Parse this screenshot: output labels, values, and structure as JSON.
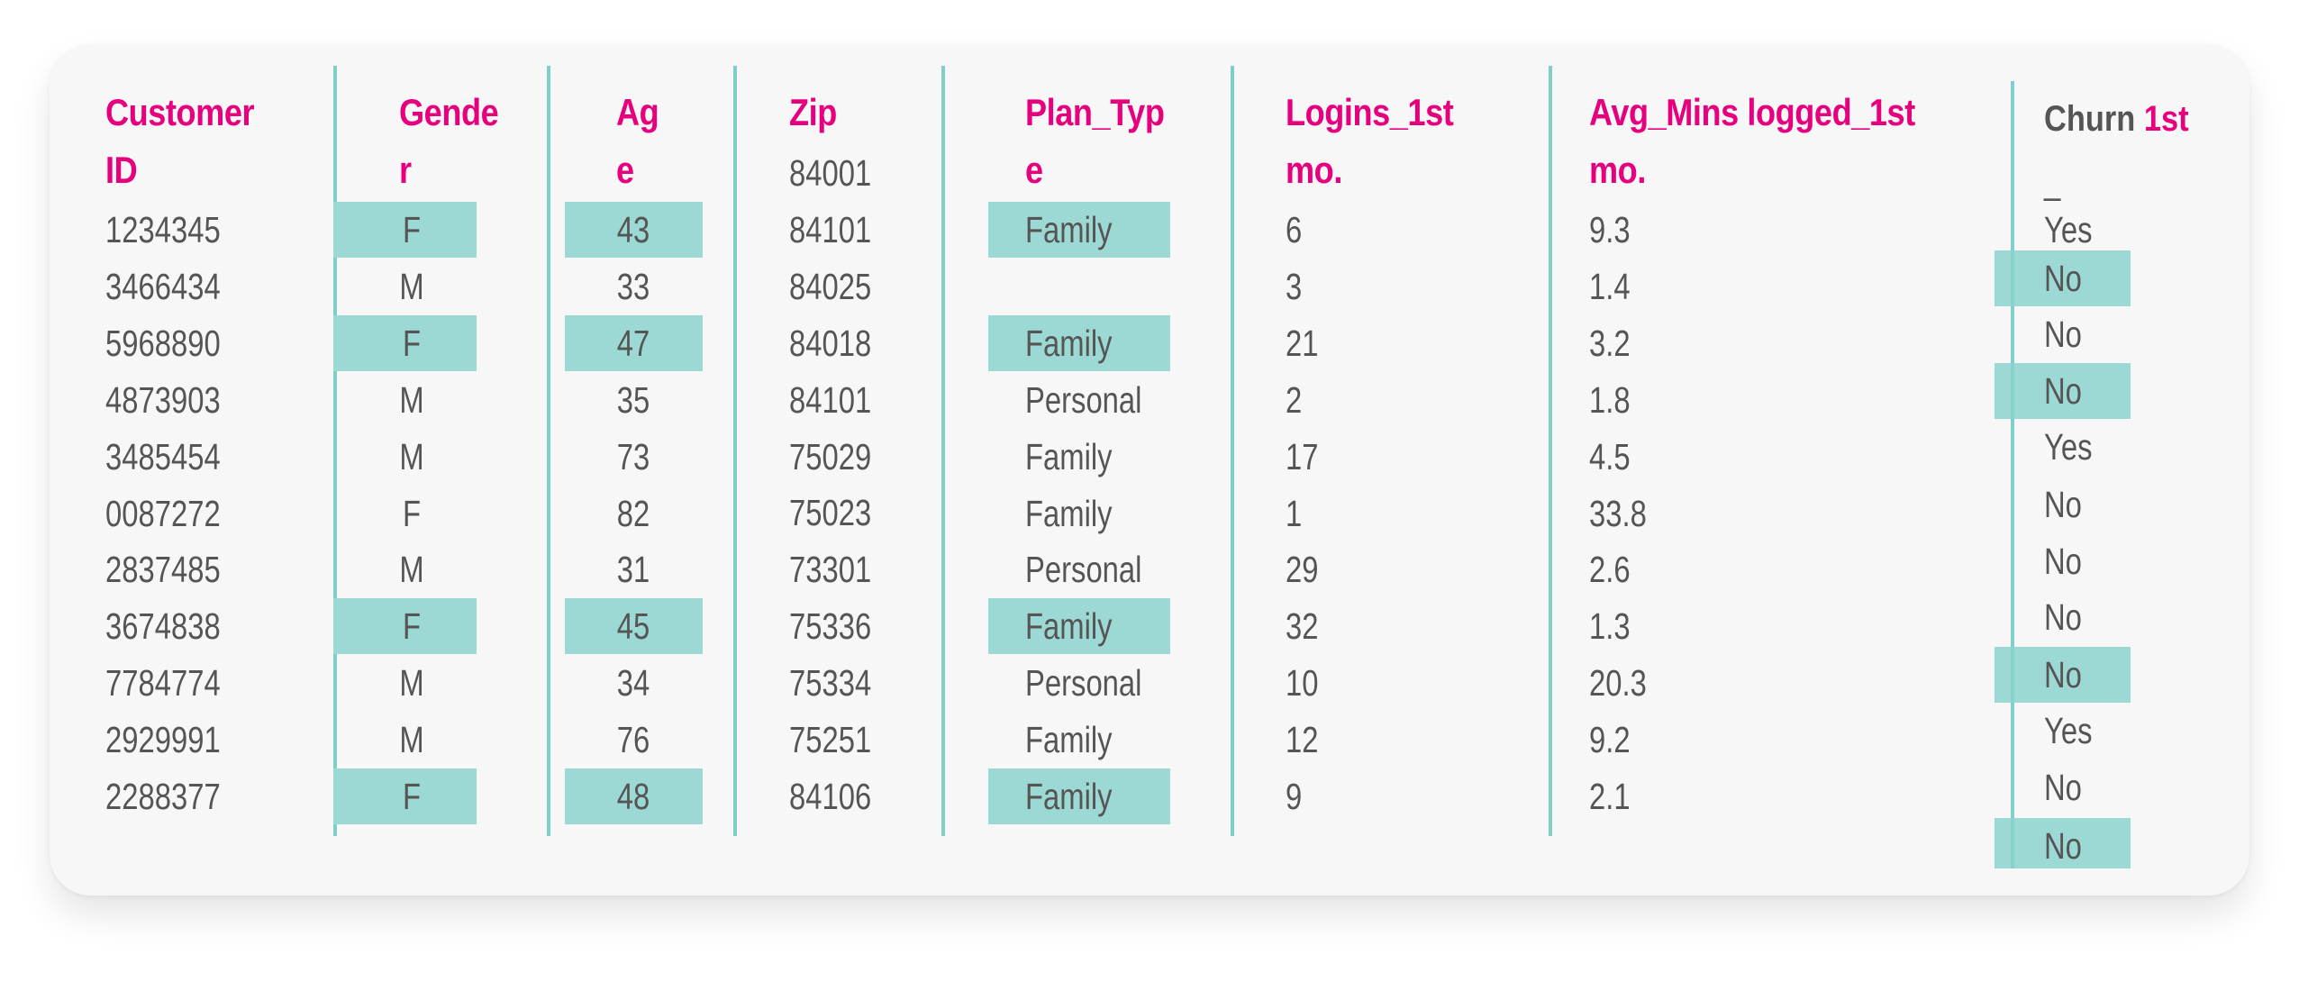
{
  "colors": {
    "header_text": "#e6007e",
    "body_text": "#555555",
    "divider": "#7fcfc9",
    "highlight": "#9dd9d4",
    "card_background": "#f7f7f7"
  },
  "headers": {
    "customer_id": [
      "Customer",
      "ID"
    ],
    "gender": [
      "Gende",
      "r"
    ],
    "age": [
      "Ag",
      "e"
    ],
    "zip": [
      "Zip"
    ],
    "plan_type": [
      "Plan_Typ",
      "e"
    ],
    "logins": [
      "Logins_1st",
      "mo."
    ],
    "avg_mins": [
      "Avg_Mins logged_1st",
      "mo."
    ],
    "churn": {
      "part1": "Churn",
      "part2": "1st",
      "line2": "_"
    }
  },
  "rows": [
    {
      "customer_id": "1234345",
      "gender": "F",
      "age": "43",
      "plan_type": "Family",
      "logins": "6",
      "avg_mins": "9.3",
      "highlight": true
    },
    {
      "customer_id": "3466434",
      "gender": "M",
      "age": "33",
      "plan_type": "",
      "logins": "3",
      "avg_mins": "1.4",
      "highlight": false
    },
    {
      "customer_id": "5968890",
      "gender": "F",
      "age": "47",
      "plan_type": "Family",
      "logins": "21",
      "avg_mins": "3.2",
      "highlight": true
    },
    {
      "customer_id": "4873903",
      "gender": "M",
      "age": "35",
      "plan_type": "Personal",
      "logins": "2",
      "avg_mins": "1.8",
      "highlight": false
    },
    {
      "customer_id": "3485454",
      "gender": "M",
      "age": "73",
      "plan_type": "Family",
      "logins": "17",
      "avg_mins": "4.5",
      "highlight": false
    },
    {
      "customer_id": "0087272",
      "gender": "F",
      "age": "82",
      "plan_type": "Family",
      "logins": "1",
      "avg_mins": "33.8",
      "highlight": false
    },
    {
      "customer_id": "2837485",
      "gender": "M",
      "age": "31",
      "plan_type": "Personal",
      "logins": "29",
      "avg_mins": "2.6",
      "highlight": false
    },
    {
      "customer_id": "3674838",
      "gender": "F",
      "age": "45",
      "plan_type": "Family",
      "logins": "32",
      "avg_mins": "1.3",
      "highlight": true
    },
    {
      "customer_id": "7784774",
      "gender": "M",
      "age": "34",
      "plan_type": "Personal",
      "logins": "10",
      "avg_mins": "20.3",
      "highlight": false
    },
    {
      "customer_id": "2929991",
      "gender": "M",
      "age": "76",
      "plan_type": "Family",
      "logins": "12",
      "avg_mins": "9.2",
      "highlight": false
    },
    {
      "customer_id": "2288377",
      "gender": "F",
      "age": "48",
      "plan_type": "Family",
      "logins": "9",
      "avg_mins": "2.1",
      "highlight": true
    }
  ],
  "zip_values": [
    "84001",
    "84101",
    "84025",
    "84018",
    "84101",
    "75029",
    "75023",
    "73301",
    "75336",
    "75334",
    "75251",
    "84106"
  ],
  "churn_values": [
    {
      "value": "Yes",
      "highlight": false
    },
    {
      "value": "No",
      "highlight": true
    },
    {
      "value": "No",
      "highlight": false
    },
    {
      "value": "No",
      "highlight": true
    },
    {
      "value": "Yes",
      "highlight": false
    },
    {
      "value": "No",
      "highlight": false
    },
    {
      "value": "No",
      "highlight": false
    },
    {
      "value": "No",
      "highlight": false
    },
    {
      "value": "No",
      "highlight": true
    },
    {
      "value": "Yes",
      "highlight": false
    },
    {
      "value": "No",
      "highlight": false
    },
    {
      "value": "No",
      "highlight": true
    }
  ]
}
